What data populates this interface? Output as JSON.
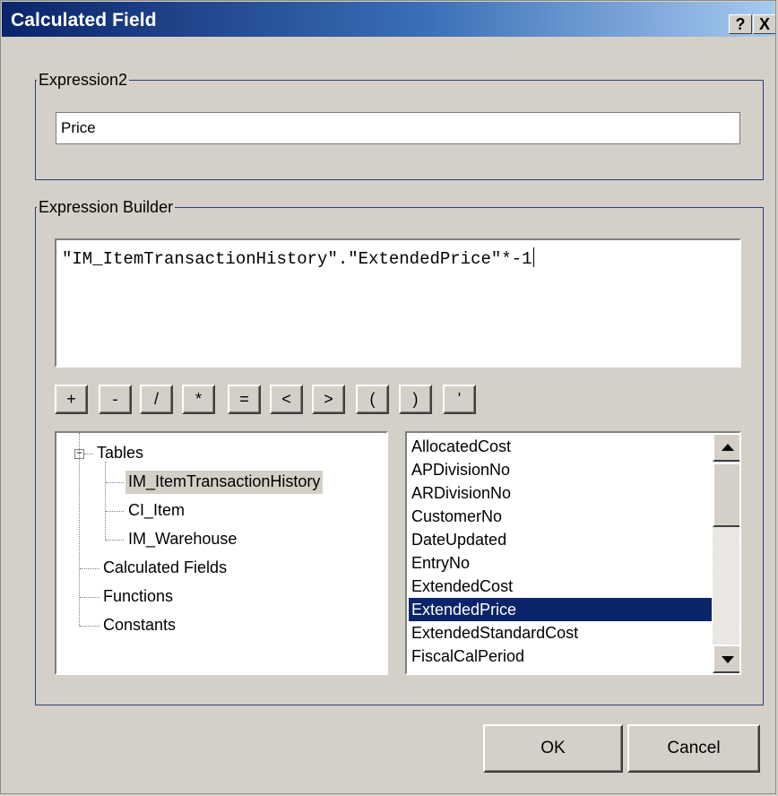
{
  "window": {
    "title": "Calculated Field",
    "help_glyph": "?",
    "close_glyph": "X"
  },
  "name_group": {
    "legend": "Expression2",
    "value": "Price"
  },
  "builder": {
    "legend": "Expression Builder",
    "expression": "\"IM_ItemTransactionHistory\".\"ExtendedPrice\"*-1",
    "operators": [
      "+",
      "-",
      "/",
      "*",
      "=",
      "<",
      ">",
      "(",
      ")",
      "'"
    ]
  },
  "tree": {
    "expander_glyph": "−",
    "root_label": "Tables",
    "tables": [
      "IM_ItemTransactionHistory",
      "CI_Item",
      "IM_Warehouse"
    ],
    "selected_table_index": 0,
    "others": [
      "Calculated Fields",
      "Functions",
      "Constants"
    ]
  },
  "fields": {
    "items": [
      "AllocatedCost",
      "APDivisionNo",
      "ARDivisionNo",
      "CustomerNo",
      "DateUpdated",
      "EntryNo",
      "ExtendedCost",
      "ExtendedPrice",
      "ExtendedStandardCost",
      "FiscalCalPeriod"
    ],
    "selected_index": 7
  },
  "buttons": {
    "ok": "OK",
    "cancel": "Cancel"
  },
  "colors": {
    "selection": "#0a246a",
    "group_border": "#2b3e7a",
    "face": "#d4d0c8"
  }
}
